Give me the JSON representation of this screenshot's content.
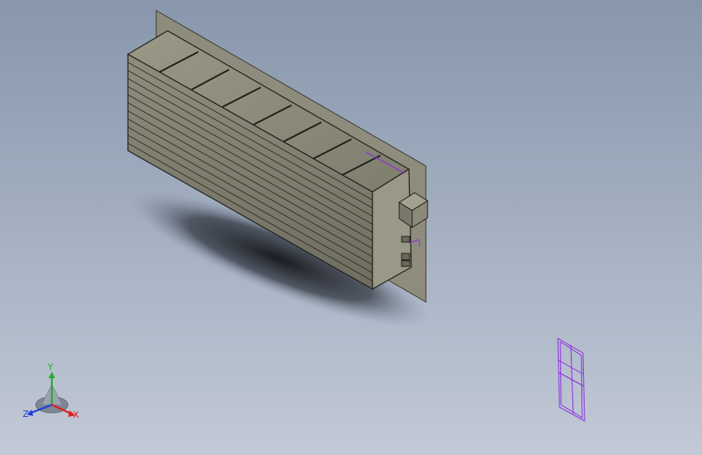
{
  "viewport": {
    "background_top": "#8897ac",
    "background_bottom": "#c2c9d6"
  },
  "model": {
    "body_color": "#8b8b7a",
    "panel_color": "#8e8c7c",
    "outline_color": "#1f1f1a",
    "selection_color": "#8a2be2"
  },
  "triad": {
    "x_label": "X",
    "y_label": "Y",
    "z_label": "Z",
    "x_color": "#e0201b",
    "y_color": "#1fae2a",
    "z_color": "#1f3fd8"
  },
  "icons": [
    "coordinate-triad-icon"
  ]
}
